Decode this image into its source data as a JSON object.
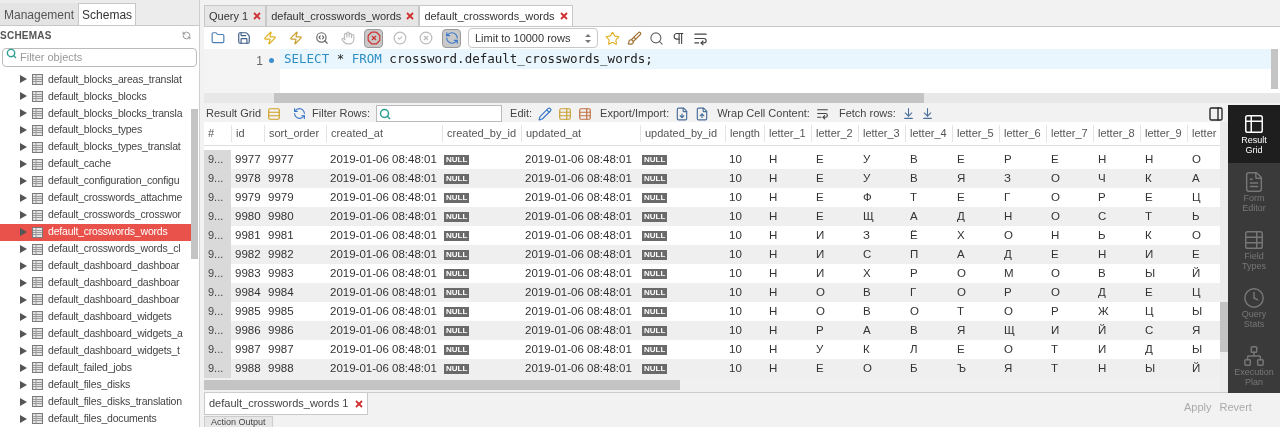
{
  "sidebar": {
    "tabs": [
      {
        "label": "Management",
        "selected": false
      },
      {
        "label": "Schemas",
        "selected": true
      }
    ],
    "heading": "SCHEMAS",
    "filter": {
      "placeholder": "Filter objects"
    },
    "items": [
      {
        "label": "default_blocks_areas_translat",
        "selected": false
      },
      {
        "label": "default_blocks_blocks",
        "selected": false
      },
      {
        "label": "default_blocks_blocks_transla",
        "selected": false
      },
      {
        "label": "default_blocks_types",
        "selected": false
      },
      {
        "label": "default_blocks_types_translat",
        "selected": false
      },
      {
        "label": "default_cache",
        "selected": false
      },
      {
        "label": "default_configuration_configu",
        "selected": false
      },
      {
        "label": "default_crosswords_attachme",
        "selected": false
      },
      {
        "label": "default_crosswords_crosswor",
        "selected": false
      },
      {
        "label": "default_crosswords_words",
        "selected": true
      },
      {
        "label": "default_crosswords_words_cl",
        "selected": false
      },
      {
        "label": "default_dashboard_dashboar",
        "selected": false
      },
      {
        "label": "default_dashboard_dashboar",
        "selected": false
      },
      {
        "label": "default_dashboard_dashboar",
        "selected": false
      },
      {
        "label": "default_dashboard_widgets",
        "selected": false
      },
      {
        "label": "default_dashboard_widgets_a",
        "selected": false
      },
      {
        "label": "default_dashboard_widgets_t",
        "selected": false
      },
      {
        "label": "default_failed_jobs",
        "selected": false
      },
      {
        "label": "default_files_disks",
        "selected": false
      },
      {
        "label": "default_files_disks_translation",
        "selected": false
      },
      {
        "label": "default_files_documents",
        "selected": false
      }
    ]
  },
  "query_tabs": [
    {
      "label": "Query 1",
      "selected": false
    },
    {
      "label": "default_crosswords_words",
      "selected": false
    },
    {
      "label": "default_crosswords_words",
      "selected": true
    }
  ],
  "toolbar": {
    "buttons": [
      {
        "kind": "open",
        "on": false
      },
      {
        "kind": "save",
        "on": false
      },
      {
        "kind": "execute",
        "on": false
      },
      {
        "kind": "execute-current",
        "on": false
      },
      {
        "kind": "explain",
        "on": false
      },
      {
        "kind": "stop",
        "on": false
      },
      {
        "kind": "stop-on-error",
        "on": true
      },
      {
        "kind": "commit",
        "on": false
      },
      {
        "kind": "rollback",
        "on": false
      },
      {
        "kind": "autocommit",
        "on": true
      }
    ],
    "limit": "Limit to 10000 rows",
    "tools": [
      {
        "kind": "snippet"
      },
      {
        "kind": "beautify"
      },
      {
        "kind": "find"
      },
      {
        "kind": "invisibles"
      },
      {
        "kind": "wrap"
      }
    ]
  },
  "editor": {
    "lines": [
      {
        "number": "1",
        "tokens": [
          {
            "text": "SELECT",
            "kind": "keyword"
          },
          {
            "text": " * ",
            "kind": "plain"
          },
          {
            "text": "FROM",
            "kind": "keyword"
          },
          {
            "text": " crossword.default_crosswords_words;",
            "kind": "plain"
          }
        ]
      }
    ]
  },
  "result_toolbar": {
    "result_grid": "Result Grid",
    "filter_rows": "Filter Rows:",
    "edit": "Edit:",
    "export_import": "Export/Import:",
    "wrap": "Wrap Cell Content:",
    "fetch_rows": "Fetch rows:"
  },
  "grid": {
    "columns": [
      "#",
      "id",
      "sort_order",
      "created_at",
      "created_by_id",
      "updated_at",
      "updated_by_id",
      "length",
      "letter_1",
      "letter_2",
      "letter_3",
      "letter_4",
      "letter_5",
      "letter_6",
      "letter_7",
      "letter_8",
      "letter_9",
      "letter"
    ],
    "rows": [
      {
        "cells": [
          "9...",
          "9977",
          "9977",
          "2019-01-06 08:48:01",
          {
            "kind": "null",
            "text": "NULL"
          },
          "2019-01-06 08:48:01",
          {
            "kind": "null",
            "text": "NULL"
          },
          "10",
          "Н",
          "Е",
          "У",
          "В",
          "Е",
          "Р",
          "Е",
          "Н",
          "Н",
          "О"
        ]
      },
      {
        "cells": [
          "9...",
          "9978",
          "9978",
          "2019-01-06 08:48:01",
          {
            "kind": "null",
            "text": "NULL"
          },
          "2019-01-06 08:48:01",
          {
            "kind": "null",
            "text": "NULL"
          },
          "10",
          "Н",
          "Е",
          "У",
          "В",
          "Я",
          "З",
          "О",
          "Ч",
          "К",
          "А"
        ]
      },
      {
        "cells": [
          "9...",
          "9979",
          "9979",
          "2019-01-06 08:48:01",
          {
            "kind": "null",
            "text": "NULL"
          },
          "2019-01-06 08:48:01",
          {
            "kind": "null",
            "text": "NULL"
          },
          "10",
          "Н",
          "Е",
          "Ф",
          "Т",
          "Е",
          "Г",
          "О",
          "Р",
          "Е",
          "Ц"
        ]
      },
      {
        "cells": [
          "9...",
          "9980",
          "9980",
          "2019-01-06 08:48:01",
          {
            "kind": "null",
            "text": "NULL"
          },
          "2019-01-06 08:48:01",
          {
            "kind": "null",
            "text": "NULL"
          },
          "10",
          "Н",
          "Е",
          "Щ",
          "А",
          "Д",
          "Н",
          "О",
          "С",
          "Т",
          "Ь"
        ]
      },
      {
        "cells": [
          "9...",
          "9981",
          "9981",
          "2019-01-06 08:48:01",
          {
            "kind": "null",
            "text": "NULL"
          },
          "2019-01-06 08:48:01",
          {
            "kind": "null",
            "text": "NULL"
          },
          "10",
          "Н",
          "И",
          "З",
          "Ё",
          "Х",
          "О",
          "Н",
          "Ь",
          "К",
          "О"
        ]
      },
      {
        "cells": [
          "9...",
          "9982",
          "9982",
          "2019-01-06 08:48:01",
          {
            "kind": "null",
            "text": "NULL"
          },
          "2019-01-06 08:48:01",
          {
            "kind": "null",
            "text": "NULL"
          },
          "10",
          "Н",
          "И",
          "С",
          "П",
          "А",
          "Д",
          "Е",
          "Н",
          "И",
          "Е"
        ]
      },
      {
        "cells": [
          "9...",
          "9983",
          "9983",
          "2019-01-06 08:48:01",
          {
            "kind": "null",
            "text": "NULL"
          },
          "2019-01-06 08:48:01",
          {
            "kind": "null",
            "text": "NULL"
          },
          "10",
          "Н",
          "И",
          "Х",
          "Р",
          "О",
          "М",
          "О",
          "В",
          "Ы",
          "Й"
        ]
      },
      {
        "cells": [
          "9...",
          "9984",
          "9984",
          "2019-01-06 08:48:01",
          {
            "kind": "null",
            "text": "NULL"
          },
          "2019-01-06 08:48:01",
          {
            "kind": "null",
            "text": "NULL"
          },
          "10",
          "Н",
          "О",
          "В",
          "Г",
          "О",
          "Р",
          "О",
          "Д",
          "Е",
          "Ц"
        ]
      },
      {
        "cells": [
          "9...",
          "9985",
          "9985",
          "2019-01-06 08:48:01",
          {
            "kind": "null",
            "text": "NULL"
          },
          "2019-01-06 08:48:01",
          {
            "kind": "null",
            "text": "NULL"
          },
          "10",
          "Н",
          "О",
          "В",
          "О",
          "Т",
          "О",
          "Р",
          "Ж",
          "Ц",
          "Ы"
        ]
      },
      {
        "cells": [
          "9...",
          "9986",
          "9986",
          "2019-01-06 08:48:01",
          {
            "kind": "null",
            "text": "NULL"
          },
          "2019-01-06 08:48:01",
          {
            "kind": "null",
            "text": "NULL"
          },
          "10",
          "Н",
          "Р",
          "А",
          "В",
          "Я",
          "Щ",
          "И",
          "Й",
          "С",
          "Я"
        ]
      },
      {
        "cells": [
          "9...",
          "9987",
          "9987",
          "2019-01-06 08:48:01",
          {
            "kind": "null",
            "text": "NULL"
          },
          "2019-01-06 08:48:01",
          {
            "kind": "null",
            "text": "NULL"
          },
          "10",
          "Н",
          "У",
          "К",
          "Л",
          "Е",
          "О",
          "Т",
          "И",
          "Д",
          "Ы"
        ]
      },
      {
        "cells": [
          "9...",
          "9988",
          "9988",
          "2019-01-06 08:48:01",
          {
            "kind": "null",
            "text": "NULL"
          },
          "2019-01-06 08:48:01",
          {
            "kind": "null",
            "text": "NULL"
          },
          "10",
          "Н",
          "Е",
          "О",
          "Б",
          "Ъ",
          "Я",
          "Т",
          "Н",
          "Ы",
          "Й"
        ]
      }
    ]
  },
  "result_tabs": [
    {
      "label": "default_crosswords_words 1",
      "selected": true
    }
  ],
  "side_panel": [
    {
      "label": "Result Grid",
      "selected": true,
      "kind": "grid"
    },
    {
      "label": "Form Editor",
      "selected": false,
      "kind": "form"
    },
    {
      "label": "Field Types",
      "selected": false,
      "kind": "fields"
    },
    {
      "label": "Query Stats",
      "selected": false,
      "kind": "stats"
    },
    {
      "label": "Execution Plan",
      "selected": false,
      "kind": "plan"
    }
  ],
  "actions": [
    {
      "label": "Apply",
      "disabled": true
    },
    {
      "label": "Revert",
      "disabled": true
    }
  ],
  "output_tab": "Action Output"
}
